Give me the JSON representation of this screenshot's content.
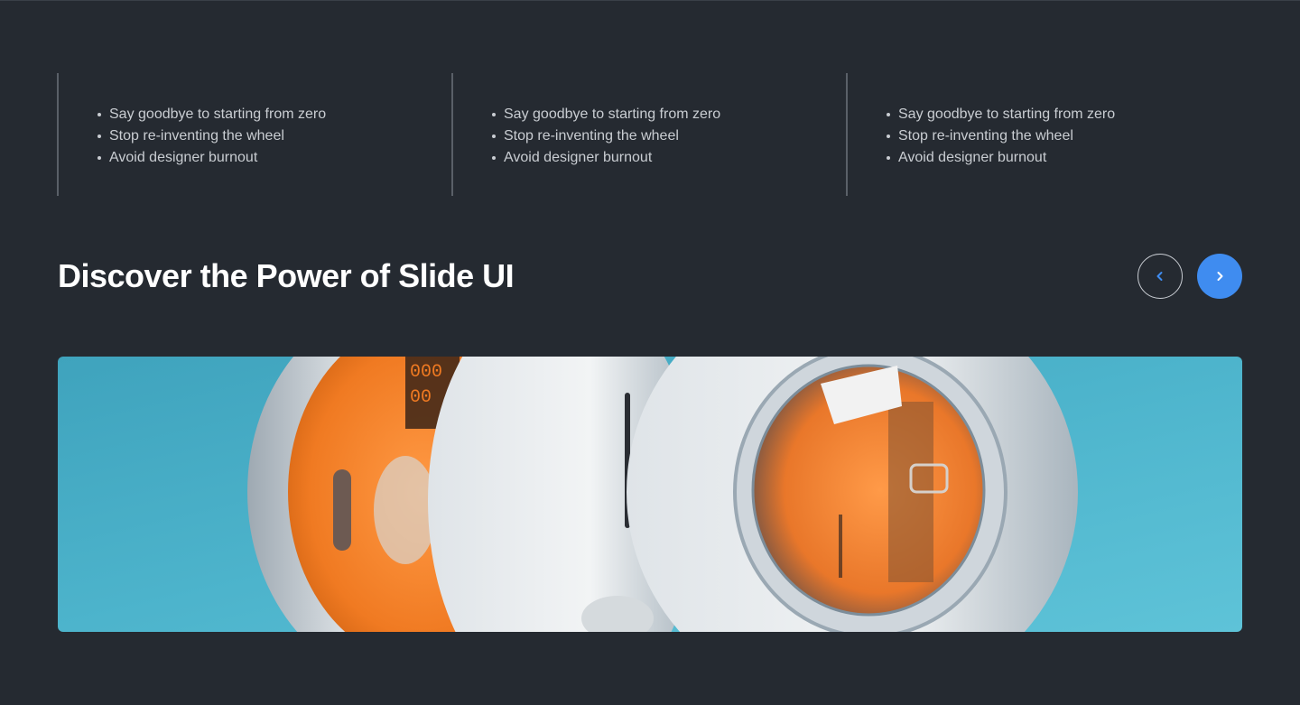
{
  "features": {
    "columns": [
      {
        "items": [
          "Say goodbye to starting from zero",
          "Stop re-inventing the wheel",
          "Avoid designer burnout"
        ]
      },
      {
        "items": [
          "Say goodbye to starting from zero",
          "Stop re-inventing the wheel",
          "Avoid designer burnout"
        ]
      },
      {
        "items": [
          "Say goodbye to starting from zero",
          "Stop re-inventing the wheel",
          "Avoid designer burnout"
        ]
      }
    ]
  },
  "section": {
    "title": "Discover the Power of Slide UI"
  },
  "carousel": {
    "prev_icon": "chevron-left-icon",
    "next_icon": "chevron-right-icon",
    "accent_color": "#3f8cf0",
    "slide_image": "futuristic-capsule-machine-illustration"
  },
  "colors": {
    "background": "#252a31",
    "text": "#c9cdd2",
    "title": "#ffffff",
    "divider": "#5a6068"
  }
}
